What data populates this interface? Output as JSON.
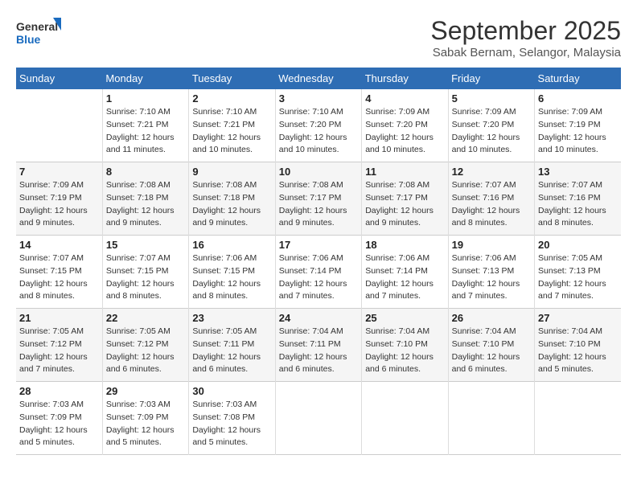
{
  "logo": {
    "line1": "General",
    "line2": "Blue"
  },
  "title": "September 2025",
  "subtitle": "Sabak Bernam, Selangor, Malaysia",
  "headers": [
    "Sunday",
    "Monday",
    "Tuesday",
    "Wednesday",
    "Thursday",
    "Friday",
    "Saturday"
  ],
  "weeks": [
    [
      {
        "day": "",
        "info": ""
      },
      {
        "day": "1",
        "info": "Sunrise: 7:10 AM\nSunset: 7:21 PM\nDaylight: 12 hours\nand 11 minutes."
      },
      {
        "day": "2",
        "info": "Sunrise: 7:10 AM\nSunset: 7:21 PM\nDaylight: 12 hours\nand 10 minutes."
      },
      {
        "day": "3",
        "info": "Sunrise: 7:10 AM\nSunset: 7:20 PM\nDaylight: 12 hours\nand 10 minutes."
      },
      {
        "day": "4",
        "info": "Sunrise: 7:09 AM\nSunset: 7:20 PM\nDaylight: 12 hours\nand 10 minutes."
      },
      {
        "day": "5",
        "info": "Sunrise: 7:09 AM\nSunset: 7:20 PM\nDaylight: 12 hours\nand 10 minutes."
      },
      {
        "day": "6",
        "info": "Sunrise: 7:09 AM\nSunset: 7:19 PM\nDaylight: 12 hours\nand 10 minutes."
      }
    ],
    [
      {
        "day": "7",
        "info": "Sunrise: 7:09 AM\nSunset: 7:19 PM\nDaylight: 12 hours\nand 9 minutes."
      },
      {
        "day": "8",
        "info": "Sunrise: 7:08 AM\nSunset: 7:18 PM\nDaylight: 12 hours\nand 9 minutes."
      },
      {
        "day": "9",
        "info": "Sunrise: 7:08 AM\nSunset: 7:18 PM\nDaylight: 12 hours\nand 9 minutes."
      },
      {
        "day": "10",
        "info": "Sunrise: 7:08 AM\nSunset: 7:17 PM\nDaylight: 12 hours\nand 9 minutes."
      },
      {
        "day": "11",
        "info": "Sunrise: 7:08 AM\nSunset: 7:17 PM\nDaylight: 12 hours\nand 9 minutes."
      },
      {
        "day": "12",
        "info": "Sunrise: 7:07 AM\nSunset: 7:16 PM\nDaylight: 12 hours\nand 8 minutes."
      },
      {
        "day": "13",
        "info": "Sunrise: 7:07 AM\nSunset: 7:16 PM\nDaylight: 12 hours\nand 8 minutes."
      }
    ],
    [
      {
        "day": "14",
        "info": "Sunrise: 7:07 AM\nSunset: 7:15 PM\nDaylight: 12 hours\nand 8 minutes."
      },
      {
        "day": "15",
        "info": "Sunrise: 7:07 AM\nSunset: 7:15 PM\nDaylight: 12 hours\nand 8 minutes."
      },
      {
        "day": "16",
        "info": "Sunrise: 7:06 AM\nSunset: 7:15 PM\nDaylight: 12 hours\nand 8 minutes."
      },
      {
        "day": "17",
        "info": "Sunrise: 7:06 AM\nSunset: 7:14 PM\nDaylight: 12 hours\nand 7 minutes."
      },
      {
        "day": "18",
        "info": "Sunrise: 7:06 AM\nSunset: 7:14 PM\nDaylight: 12 hours\nand 7 minutes."
      },
      {
        "day": "19",
        "info": "Sunrise: 7:06 AM\nSunset: 7:13 PM\nDaylight: 12 hours\nand 7 minutes."
      },
      {
        "day": "20",
        "info": "Sunrise: 7:05 AM\nSunset: 7:13 PM\nDaylight: 12 hours\nand 7 minutes."
      }
    ],
    [
      {
        "day": "21",
        "info": "Sunrise: 7:05 AM\nSunset: 7:12 PM\nDaylight: 12 hours\nand 7 minutes."
      },
      {
        "day": "22",
        "info": "Sunrise: 7:05 AM\nSunset: 7:12 PM\nDaylight: 12 hours\nand 6 minutes."
      },
      {
        "day": "23",
        "info": "Sunrise: 7:05 AM\nSunset: 7:11 PM\nDaylight: 12 hours\nand 6 minutes."
      },
      {
        "day": "24",
        "info": "Sunrise: 7:04 AM\nSunset: 7:11 PM\nDaylight: 12 hours\nand 6 minutes."
      },
      {
        "day": "25",
        "info": "Sunrise: 7:04 AM\nSunset: 7:10 PM\nDaylight: 12 hours\nand 6 minutes."
      },
      {
        "day": "26",
        "info": "Sunrise: 7:04 AM\nSunset: 7:10 PM\nDaylight: 12 hours\nand 6 minutes."
      },
      {
        "day": "27",
        "info": "Sunrise: 7:04 AM\nSunset: 7:10 PM\nDaylight: 12 hours\nand 5 minutes."
      }
    ],
    [
      {
        "day": "28",
        "info": "Sunrise: 7:03 AM\nSunset: 7:09 PM\nDaylight: 12 hours\nand 5 minutes."
      },
      {
        "day": "29",
        "info": "Sunrise: 7:03 AM\nSunset: 7:09 PM\nDaylight: 12 hours\nand 5 minutes."
      },
      {
        "day": "30",
        "info": "Sunrise: 7:03 AM\nSunset: 7:08 PM\nDaylight: 12 hours\nand 5 minutes."
      },
      {
        "day": "",
        "info": ""
      },
      {
        "day": "",
        "info": ""
      },
      {
        "day": "",
        "info": ""
      },
      {
        "day": "",
        "info": ""
      }
    ]
  ]
}
